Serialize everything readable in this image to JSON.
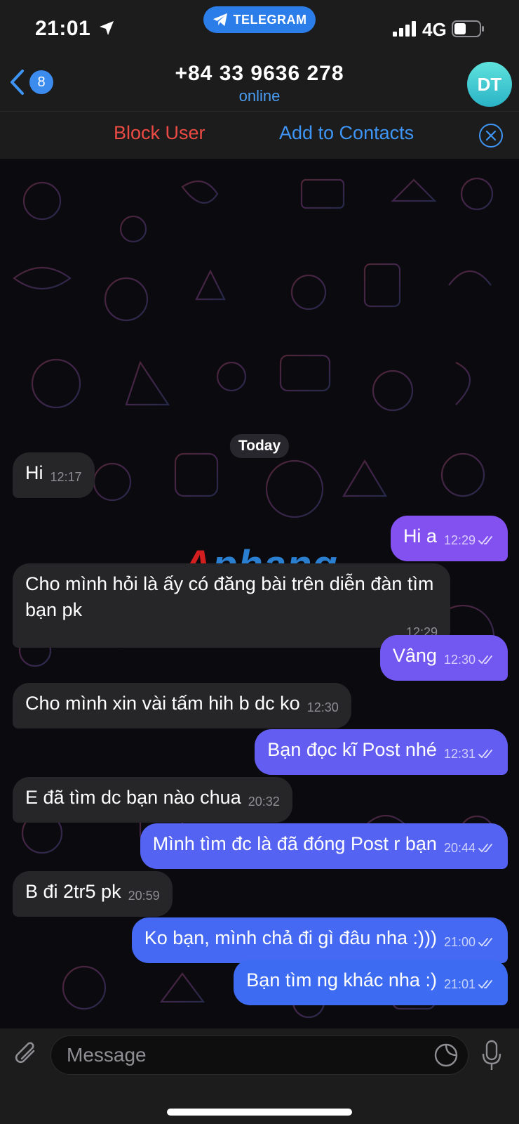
{
  "status_bar": {
    "time": "21:01",
    "network": "4G",
    "pill_label": "TELEGRAM"
  },
  "header": {
    "back_badge": "8",
    "title": "+84 33 9636 278",
    "subtitle": "online",
    "avatar_initials": "DT"
  },
  "action_bar": {
    "block_label": "Block User",
    "add_label": "Add to Contacts"
  },
  "chat": {
    "date_label": "Today",
    "watermark_first": "A",
    "watermark_rest": "phang",
    "messages": [
      {
        "dir": "in",
        "text": "Hi",
        "time": "12:17"
      },
      {
        "dir": "out",
        "text": "Hi a",
        "time": "12:29"
      },
      {
        "dir": "in",
        "text": "Cho mình hỏi là ấy có đăng bài trên diễn đàn tìm bạn pk",
        "time": "12:29"
      },
      {
        "dir": "out",
        "text": "Vâng",
        "time": "12:30"
      },
      {
        "dir": "in",
        "text": "Cho mình xin vài tấm hih b dc ko",
        "time": "12:30"
      },
      {
        "dir": "out",
        "text": "Bạn đọc kĩ Post nhé",
        "time": "12:31"
      },
      {
        "dir": "in",
        "text": "E đã tìm dc bạn nào chua",
        "time": "20:32"
      },
      {
        "dir": "out",
        "text": "Mình tìm đc là đã đóng Post r bạn",
        "time": "20:44"
      },
      {
        "dir": "in",
        "text": "B đi 2tr5 pk",
        "time": "20:59"
      },
      {
        "dir": "out",
        "text": "Ko bạn, mình chả đi gì đâu nha :)))",
        "time": "21:00"
      },
      {
        "dir": "out",
        "text": "Bạn tìm ng khác nha :)",
        "time": "21:01"
      }
    ]
  },
  "input": {
    "placeholder": "Message"
  },
  "colors": {
    "accent": "#3e95f5",
    "danger": "#ec4b43",
    "incoming_bubble": "#262628",
    "outgoing_top": "#8a4ef0",
    "outgoing_bottom": "#3d6cf2"
  },
  "icons": [
    "location-arrow-icon",
    "telegram-plane-icon",
    "signal-icon",
    "battery-icon",
    "chevron-left-icon",
    "close-circle-icon",
    "attach-icon",
    "sticker-icon",
    "mic-icon",
    "double-check-icon"
  ]
}
